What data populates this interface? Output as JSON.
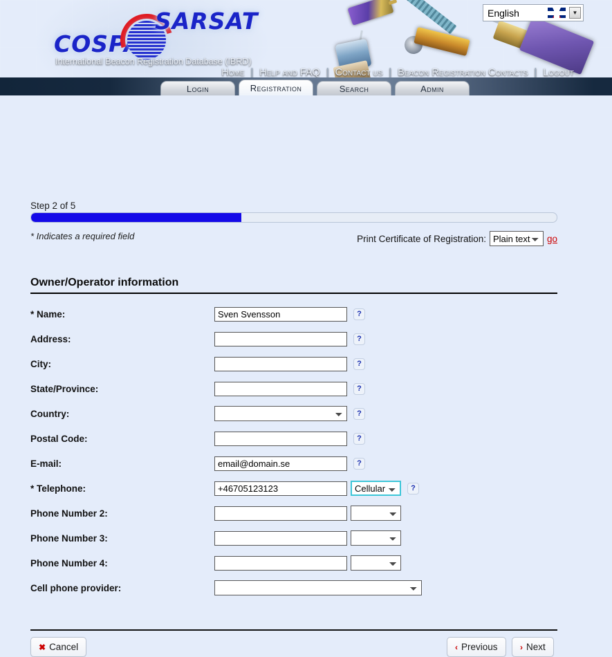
{
  "header": {
    "logo": {
      "cospas": "COSPAS",
      "sarsat": "SARSAT",
      "subtitle": "International Beacon Registration Database (IBRD)"
    },
    "language": {
      "value": "English",
      "flag": "uk-flag-icon",
      "arrow": "▼"
    },
    "nav": [
      {
        "label": "Home"
      },
      {
        "label": "Help and FAQ"
      },
      {
        "label": "Contact us"
      },
      {
        "label": "Beacon Registration Contacts"
      },
      {
        "label": "Logout"
      }
    ],
    "nav_separator": "|",
    "tabs": [
      {
        "label": "Login",
        "active": false
      },
      {
        "label": "Registration",
        "active": true
      },
      {
        "label": "Search",
        "active": false
      },
      {
        "label": "Admin",
        "active": false
      }
    ]
  },
  "wizard": {
    "step_label": "Step 2 of 5",
    "progress_percent": 40,
    "required_note": "* Indicates a required field"
  },
  "print_certificate": {
    "label": "Print Certificate of Registration:",
    "format_value": "Plain text",
    "format_options": [
      "Plain text"
    ],
    "go_label": "go"
  },
  "section": {
    "title": "Owner/Operator information"
  },
  "fields": [
    {
      "label": "* Name:",
      "type": "text",
      "value": "Sven Svensson",
      "help": true
    },
    {
      "label": "Address:",
      "type": "text",
      "value": "",
      "help": true
    },
    {
      "label": "City:",
      "type": "text",
      "value": "",
      "help": true
    },
    {
      "label": "State/Province:",
      "type": "text",
      "value": "",
      "help": true
    },
    {
      "label": "Country:",
      "type": "select",
      "value": "",
      "help": true
    },
    {
      "label": "Postal Code:",
      "type": "text",
      "value": "",
      "help": true
    },
    {
      "label": "E-mail:",
      "type": "text",
      "value": "email@domain.se",
      "help": true
    },
    {
      "label": "* Telephone:",
      "type": "text-select",
      "value": "+46705123123",
      "select_value": "Cellular",
      "help": true,
      "focused": true
    },
    {
      "label": "Phone Number 2:",
      "type": "text-select",
      "value": "",
      "select_value": "",
      "help": false
    },
    {
      "label": "Phone Number 3:",
      "type": "text-select",
      "value": "",
      "select_value": "",
      "help": false
    },
    {
      "label": "Phone Number 4:",
      "type": "text-select",
      "value": "",
      "select_value": "",
      "help": false
    },
    {
      "label": "Cell phone provider:",
      "type": "select-wide",
      "value": "",
      "help": false
    }
  ],
  "help_glyph": "?",
  "footer": {
    "cancel": {
      "icon": "✖",
      "label": "Cancel"
    },
    "previous": {
      "icon": "‹",
      "label": "Previous"
    },
    "next": {
      "icon": "›",
      "label": "Next"
    }
  },
  "colors": {
    "header_dark": "#16293f",
    "page_bg": "#e4ecfa",
    "progress_fill": "#1409e8",
    "accent_red": "#cc0000",
    "logo_blue": "#1a24c8",
    "logo_red": "#e01b22",
    "focus_cyan": "#3ec6d8"
  }
}
